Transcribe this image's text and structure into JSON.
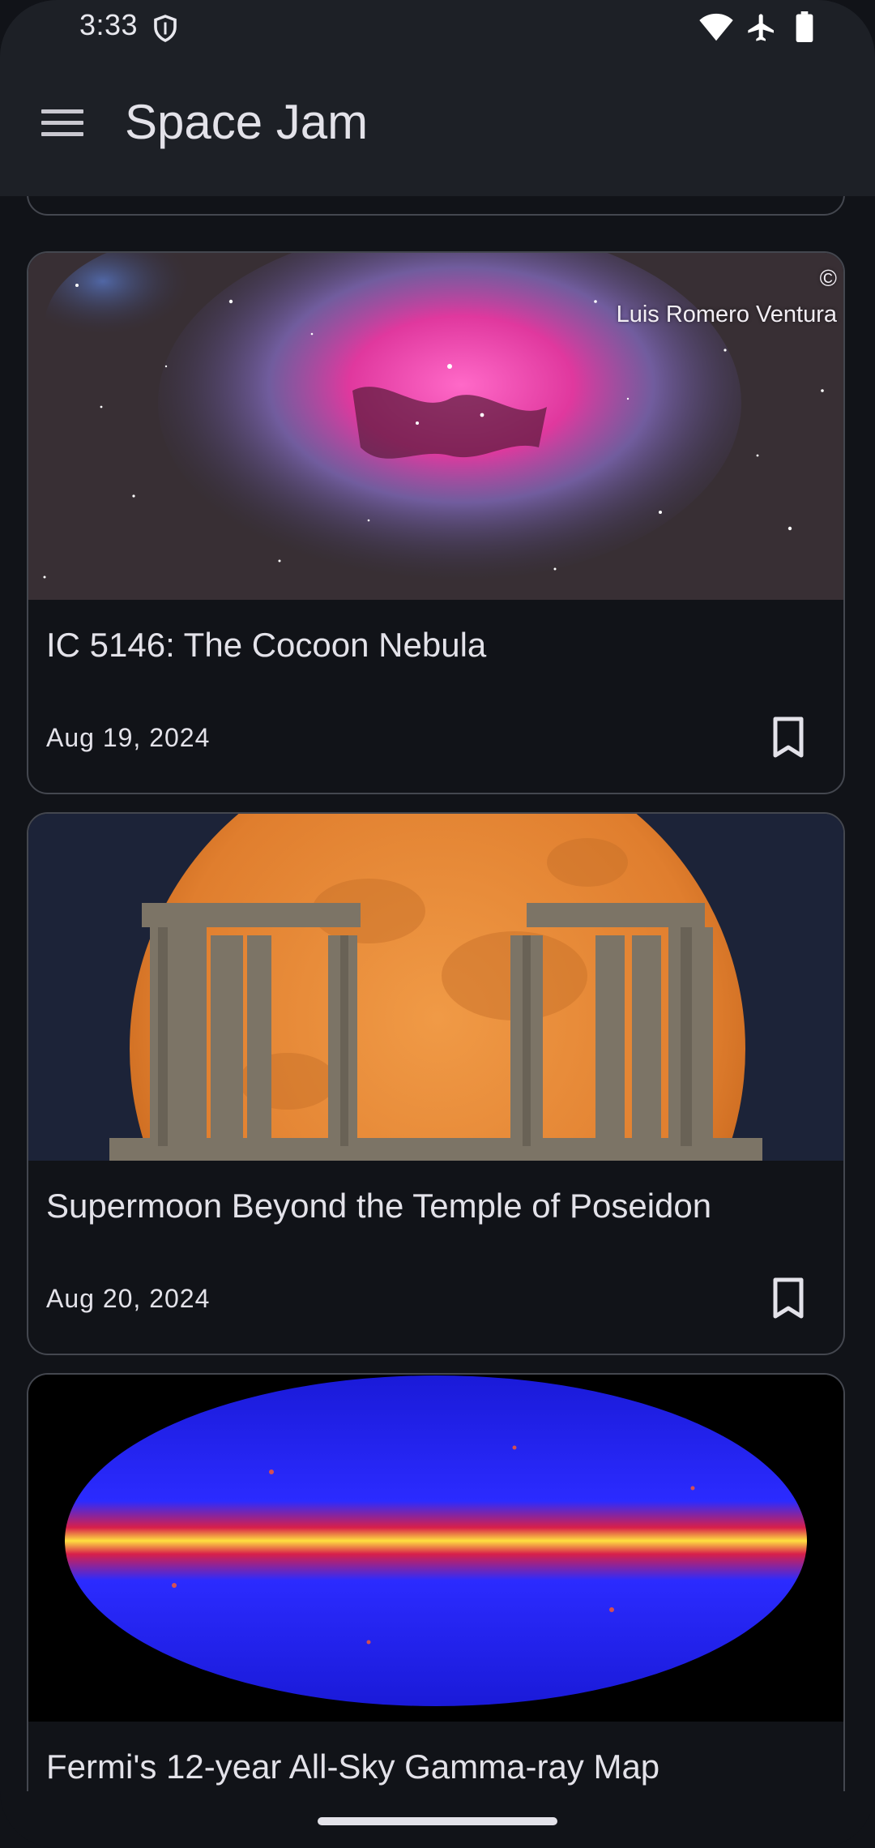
{
  "status_bar": {
    "time": "3:33"
  },
  "app_bar": {
    "title": "Space Jam",
    "menu_icon": "menu-icon"
  },
  "feed": {
    "cards": [
      {
        "title": "IC 5146: The Cocoon Nebula",
        "date": "Aug 19, 2024",
        "credit_symbol": "©",
        "credit_name": "Luis Romero Ventura",
        "image": "nebula-image"
      },
      {
        "title": "Supermoon Beyond the Temple of Poseidon",
        "date": "Aug 20, 2024",
        "image": "supermoon-temple-image"
      },
      {
        "title": "Fermi's 12-year All-Sky Gamma-ray Map",
        "image": "gamma-ray-map-image"
      }
    ]
  },
  "colors": {
    "background": "#111318",
    "surface": "#1d2026",
    "outline": "#44474f",
    "on_surface": "#e3e2e9"
  }
}
